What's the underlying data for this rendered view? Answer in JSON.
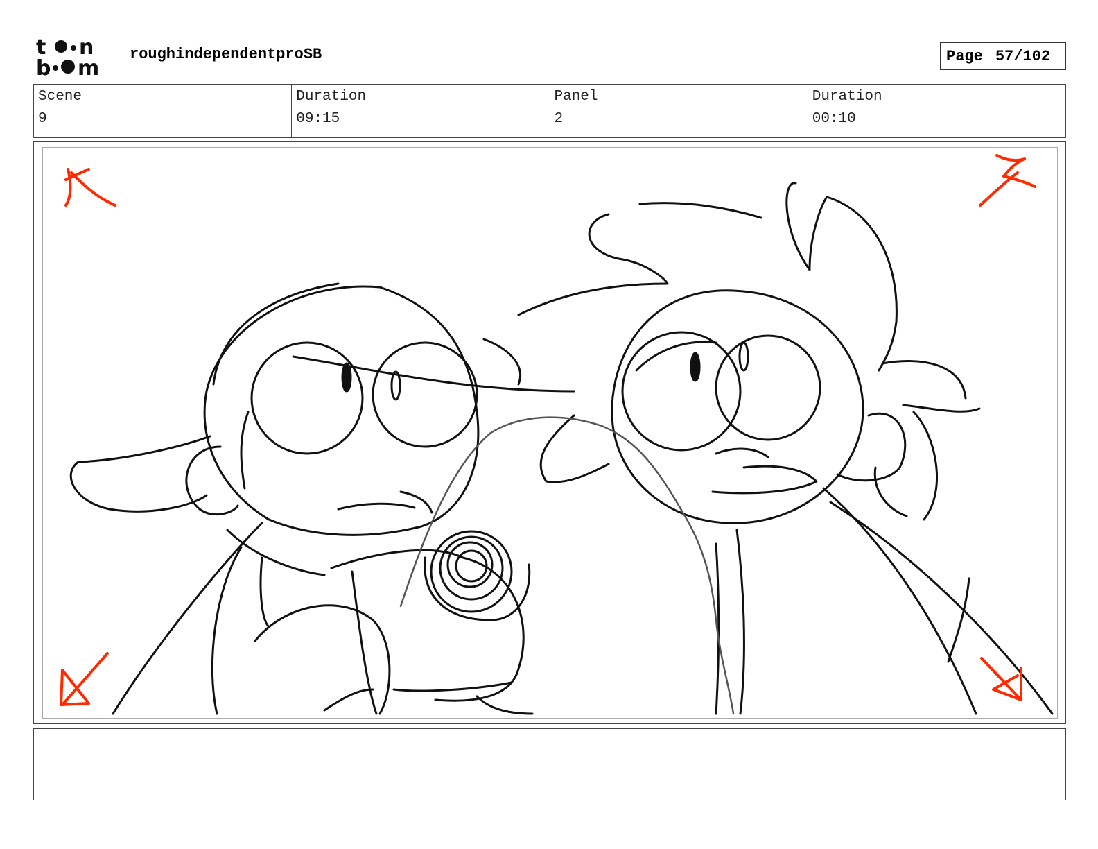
{
  "header": {
    "logo_text_top": "toon",
    "logo_text_bottom": "boom",
    "project_title": "roughindependentproSB",
    "page_label": "Page",
    "page_value": "57/102"
  },
  "info": {
    "scene_label": "Scene",
    "scene_value": "9",
    "scene_duration_label": "Duration",
    "scene_duration_value": "09:15",
    "panel_label": "Panel",
    "panel_value": "2",
    "panel_duration_label": "Duration",
    "panel_duration_value": "00:10"
  },
  "notes": {
    "text": ""
  },
  "colors": {
    "corner_marks": "#ff2a00",
    "sketch": "#111111",
    "sketch_light": "#555555"
  }
}
